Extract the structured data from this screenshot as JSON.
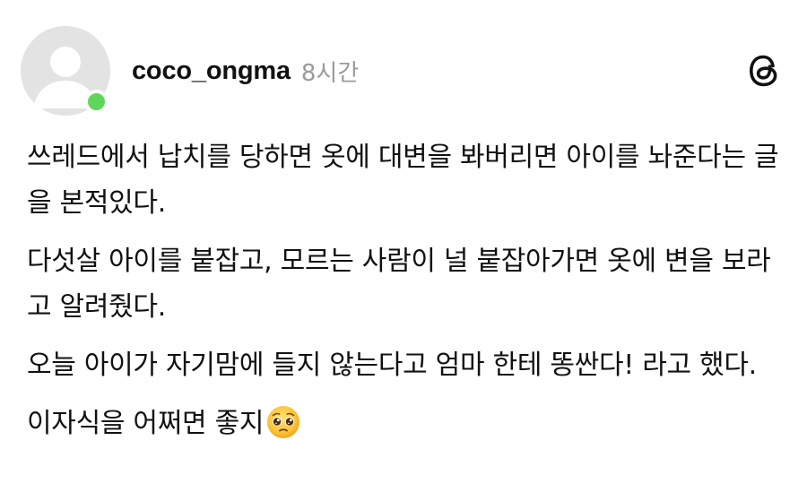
{
  "post": {
    "username": "coco_ongma",
    "time_ago": "8시간",
    "icons": {
      "avatar": "default-avatar-icon",
      "status": "online-status-dot",
      "app": "threads-logo-icon",
      "emoji": "pleading-face-emoji"
    },
    "colors": {
      "online": "#5fd65a",
      "timestamp": "#9a9a9a",
      "avatar_bg": "#e3e3e3"
    },
    "paragraphs": [
      "쓰레드에서 납치를 당하면 옷에 대변을 봐버리면 아이를 놔준다는 글을 본적있다.",
      "다섯살 아이를 붙잡고, 모르는 사람이 널 붙잡아가면 옷에 변을 보라고 알려줬다.",
      "오늘 아이가 자기맘에 들지 않는다고 엄마 한테 똥싼다! 라고 했다.",
      "이자식을 어쩌면 좋지"
    ]
  }
}
